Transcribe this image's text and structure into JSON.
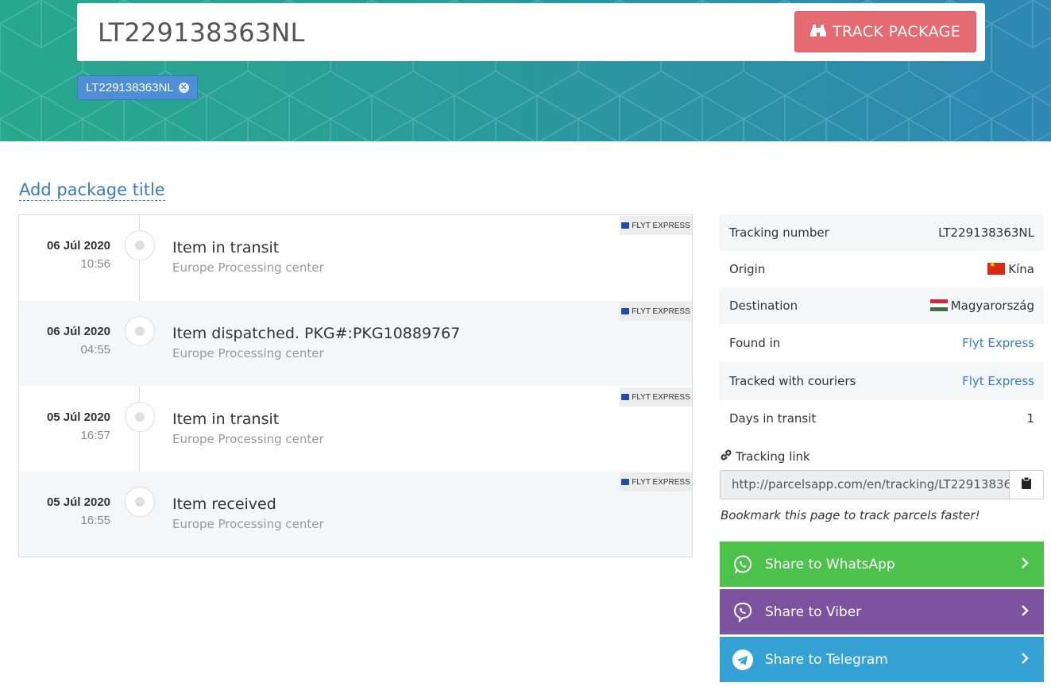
{
  "search": {
    "value": "LT229138363NL",
    "button_label": "TRACK PACKAGE"
  },
  "tag": {
    "label": "LT229138363NL"
  },
  "add_title": "Add package title",
  "events": [
    {
      "date": "06 Júl 2020",
      "time": "10:56",
      "title": "Item in transit",
      "location": "Europe Processing center",
      "courier": "FLYT EXPRESS"
    },
    {
      "date": "06 Júl 2020",
      "time": "04:55",
      "title": "Item dispatched. PKG#:PKG10889767",
      "location": "Europe Processing center",
      "courier": "FLYT EXPRESS"
    },
    {
      "date": "05 Júl 2020",
      "time": "16:57",
      "title": "Item in transit",
      "location": "Europe Processing center",
      "courier": "FLYT EXPRESS"
    },
    {
      "date": "05 Júl 2020",
      "time": "16:55",
      "title": "Item received",
      "location": "Europe Processing center",
      "courier": "FLYT EXPRESS"
    }
  ],
  "info": {
    "tracking_number": {
      "label": "Tracking number",
      "value": "LT229138363NL"
    },
    "origin": {
      "label": "Origin",
      "value": "Kína"
    },
    "destination": {
      "label": "Destination",
      "value": "Magyarország"
    },
    "found_in": {
      "label": "Found in",
      "value": "Flyt Express"
    },
    "tracked_with": {
      "label": "Tracked with couriers",
      "value": "Flyt Express"
    },
    "days": {
      "label": "Days in transit",
      "value": "1"
    }
  },
  "tracking_link": {
    "label": "Tracking link",
    "url": "http://parcelsapp.com/en/tracking/LT229138363NL",
    "bookmark_note": "Bookmark this page to track parcels faster!"
  },
  "share": {
    "whatsapp": "Share to WhatsApp",
    "viber": "Share to Viber",
    "telegram": "Share to Telegram"
  },
  "colors": {
    "track_button": "#e56a71",
    "tag": "#4c8fd6",
    "link": "#3a7bbf",
    "whatsapp": "#4cc14b",
    "viber": "#7d539f",
    "telegram": "#35a2d6"
  },
  "icons": {
    "track_button": "binoculars-icon",
    "tag_remove": "close-icon",
    "tracking_link": "link-icon",
    "copy": "clipboard-icon",
    "whatsapp": "whatsapp-icon",
    "viber": "viber-icon",
    "telegram": "telegram-icon",
    "share_arrow": "chevron-right-icon"
  }
}
